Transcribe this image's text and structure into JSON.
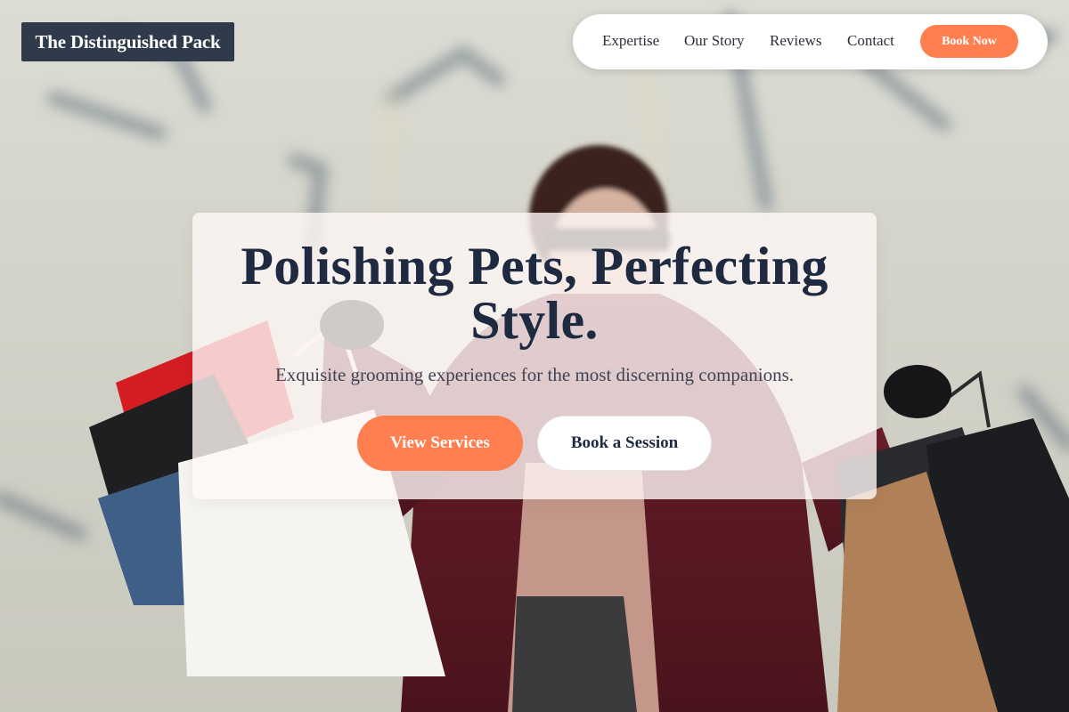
{
  "brand": {
    "name": "The Distinguished Pack"
  },
  "nav": {
    "links": [
      {
        "label": "Expertise"
      },
      {
        "label": "Our Story"
      },
      {
        "label": "Reviews"
      },
      {
        "label": "Contact"
      }
    ],
    "cta_label": "Book Now"
  },
  "hero": {
    "title": "Polishing Pets, Perfecting Style.",
    "subtitle": "Exquisite grooming experiences for the most discerning companions.",
    "primary_label": "View Services",
    "secondary_label": "Book a Session",
    "background_icon": "shopping-photo"
  },
  "colors": {
    "accent": "#ff7f50",
    "brand_dark": "#2f3a4a",
    "title": "#1e2a40",
    "nav_bg": "#ffffff"
  }
}
